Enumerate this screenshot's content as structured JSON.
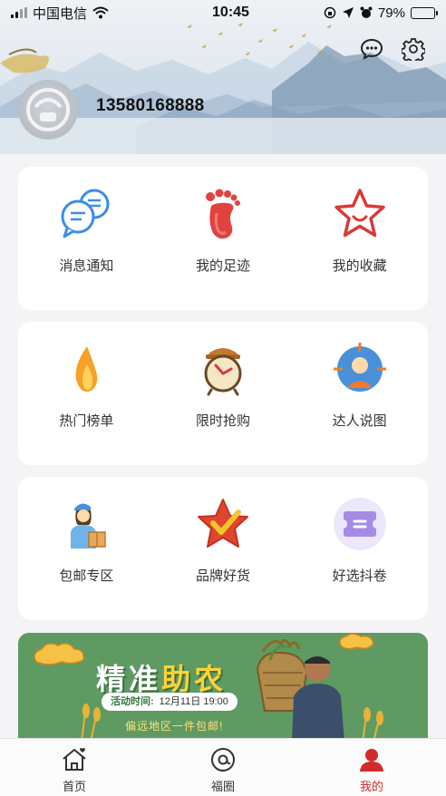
{
  "status_bar": {
    "carrier": "中国电信",
    "time": "10:45",
    "battery": "79%",
    "battery_level": 0.79
  },
  "profile": {
    "phone": "13580168888"
  },
  "header_actions": [
    {
      "icon": "message-icon"
    },
    {
      "icon": "gear-icon"
    }
  ],
  "cards": [
    {
      "items": [
        {
          "label": "消息通知",
          "icon": "chat-bubbles-icon"
        },
        {
          "label": "我的足迹",
          "icon": "footprint-icon"
        },
        {
          "label": "我的收藏",
          "icon": "star-outline-icon"
        }
      ]
    },
    {
      "items": [
        {
          "label": "热门榜单",
          "icon": "flame-icon"
        },
        {
          "label": "限时抢购",
          "icon": "alarm-clock-icon"
        },
        {
          "label": "达人说图",
          "icon": "target-person-icon"
        }
      ]
    },
    {
      "items": [
        {
          "label": "包邮专区",
          "icon": "courier-icon"
        },
        {
          "label": "品牌好货",
          "icon": "check-star-icon"
        },
        {
          "label": "好选抖卷",
          "icon": "coupon-icon"
        }
      ]
    }
  ],
  "promo": {
    "title_part1": "精准",
    "title_part2": "助农",
    "time_label": "活动时间:",
    "time_value": "12月11日 19:00",
    "subtitle": "偏远地区一件包邮!"
  },
  "tabbar": [
    {
      "label": "首页",
      "icon": "home-icon",
      "active": false
    },
    {
      "label": "福圈",
      "icon": "circle-icon",
      "active": false
    },
    {
      "label": "我的",
      "icon": "user-icon",
      "active": true
    }
  ],
  "colors": {
    "accent": "#d22b2b",
    "promo_green": "#5f9a62",
    "promo_yellow": "#ffd234"
  }
}
